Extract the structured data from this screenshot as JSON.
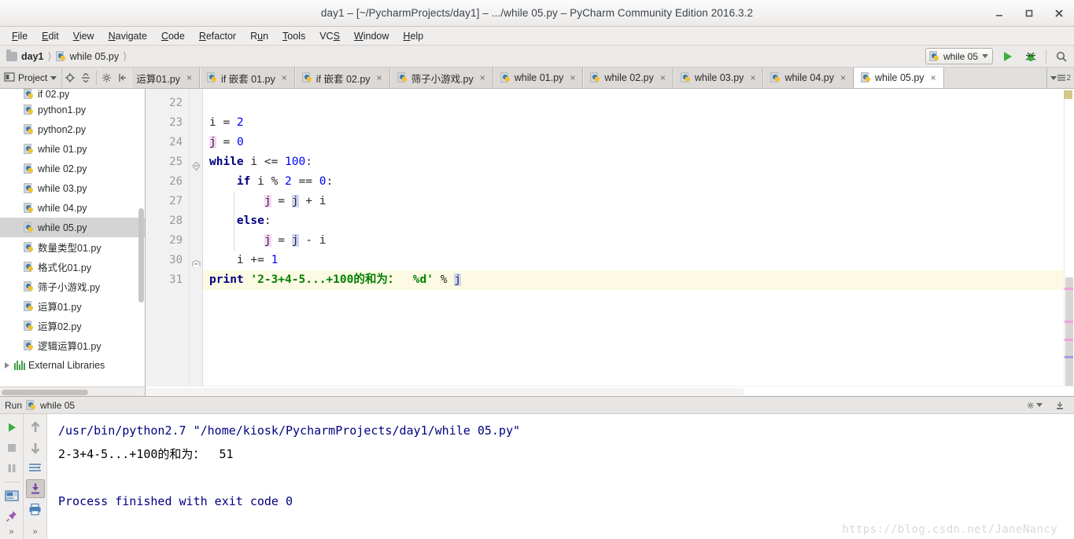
{
  "window": {
    "title": "day1 – [~/PycharmProjects/day1] – .../while 05.py – PyCharm Community Edition 2016.3.2",
    "minimize_label": "–",
    "maximize_label": "□",
    "close_label": "×"
  },
  "menubar": {
    "items": [
      {
        "pre": "",
        "mn": "F",
        "post": "ile",
        "name": "menu-file"
      },
      {
        "pre": "",
        "mn": "E",
        "post": "dit",
        "name": "menu-edit"
      },
      {
        "pre": "",
        "mn": "V",
        "post": "iew",
        "name": "menu-view"
      },
      {
        "pre": "",
        "mn": "N",
        "post": "avigate",
        "name": "menu-navigate"
      },
      {
        "pre": "",
        "mn": "C",
        "post": "ode",
        "name": "menu-code"
      },
      {
        "pre": "",
        "mn": "R",
        "post": "efactor",
        "name": "menu-refactor"
      },
      {
        "pre": "R",
        "mn": "u",
        "post": "n",
        "name": "menu-run"
      },
      {
        "pre": "",
        "mn": "T",
        "post": "ools",
        "name": "menu-tools"
      },
      {
        "pre": "VC",
        "mn": "S",
        "post": "",
        "name": "menu-vcs"
      },
      {
        "pre": "",
        "mn": "W",
        "post": "indow",
        "name": "menu-window"
      },
      {
        "pre": "",
        "mn": "H",
        "post": "elp",
        "name": "menu-help"
      }
    ]
  },
  "navbar": {
    "crumb_project": "day1",
    "crumb_file": "while 05.py",
    "run_config": "while 05",
    "run_button": "run-button",
    "debug_button": "debug-button",
    "search_button": "search-everywhere"
  },
  "tabbar": {
    "project_label": "Project",
    "tabs": [
      {
        "label": "运算01.py",
        "icon": false,
        "active": false
      },
      {
        "label": "if 嵌套 01.py",
        "icon": true,
        "active": false
      },
      {
        "label": "if 嵌套 02.py",
        "icon": true,
        "active": false
      },
      {
        "label": "筛子小游戏.py",
        "icon": true,
        "active": false
      },
      {
        "label": "while 01.py",
        "icon": true,
        "active": false
      },
      {
        "label": "while 02.py",
        "icon": true,
        "active": false
      },
      {
        "label": "while 03.py",
        "icon": true,
        "active": false
      },
      {
        "label": "while 04.py",
        "icon": true,
        "active": false
      },
      {
        "label": "while 05.py",
        "icon": true,
        "active": true
      }
    ],
    "overflow_count": "2",
    "close_glyph": "×"
  },
  "project_tree": {
    "items": [
      {
        "label": "if 02.py",
        "type": "py",
        "clipped": true,
        "selected": false
      },
      {
        "label": "python1.py",
        "type": "py",
        "selected": false
      },
      {
        "label": "python2.py",
        "type": "py",
        "selected": false
      },
      {
        "label": "while 01.py",
        "type": "py",
        "selected": false
      },
      {
        "label": "while 02.py",
        "type": "py",
        "selected": false
      },
      {
        "label": "while 03.py",
        "type": "py",
        "selected": false
      },
      {
        "label": "while 04.py",
        "type": "py",
        "selected": false
      },
      {
        "label": "while 05.py",
        "type": "py",
        "selected": true
      },
      {
        "label": "数量类型01.py",
        "type": "py",
        "selected": false
      },
      {
        "label": "格式化01.py",
        "type": "py",
        "selected": false
      },
      {
        "label": "筛子小游戏.py",
        "type": "py",
        "selected": false
      },
      {
        "label": "运算01.py",
        "type": "py",
        "selected": false
      },
      {
        "label": "运算02.py",
        "type": "py",
        "selected": false
      },
      {
        "label": "逻辑运算01.py",
        "type": "py",
        "selected": false
      },
      {
        "label": "External Libraries",
        "type": "lib",
        "selected": false
      }
    ]
  },
  "editor": {
    "line_numbers": [
      "22",
      "23",
      "24",
      "25",
      "26",
      "27",
      "28",
      "29",
      "30",
      "31"
    ],
    "lines": [
      {
        "n": "22",
        "text": "",
        "highlight": false
      },
      {
        "n": "23",
        "text": "i = 2",
        "highlight": false
      },
      {
        "n": "24",
        "text": "j = 0",
        "highlight": false
      },
      {
        "n": "25",
        "text": "while i <= 100:",
        "highlight": false
      },
      {
        "n": "26",
        "text": "    if i % 2 == 0:",
        "highlight": false
      },
      {
        "n": "27",
        "text": "        j = j + i",
        "highlight": false
      },
      {
        "n": "28",
        "text": "    else:",
        "highlight": false
      },
      {
        "n": "29",
        "text": "        j = j - i",
        "highlight": false
      },
      {
        "n": "30",
        "text": "    i += 1",
        "highlight": false
      },
      {
        "n": "31",
        "text": "print '2-3+4-5...+100的和为：  %d' % j",
        "highlight": true
      }
    ],
    "colors": {
      "keyword": "#000080",
      "number": "#0000ff",
      "string": "#008000",
      "write_highlight": "#f7d6f7",
      "read_highlight": "#d0d4f7",
      "caret_line": "#fdfae4"
    }
  },
  "run_panel": {
    "header_label": "Run",
    "header_config": "while 05",
    "toolbar": {
      "rerun": "rerun-button",
      "stop": "stop-button",
      "pause": "pause-button",
      "console": "console-button",
      "pin": "pin-tab-button",
      "up": "scroll-up-button",
      "down": "scroll-down-button",
      "soft_wrap": "soft-wrap-button",
      "scroll_to_end": "scroll-to-end-button",
      "print": "print-button",
      "more": "»",
      "settings": "settings-gear",
      "hide": "hide-button"
    },
    "console_lines": [
      {
        "text": "/usr/bin/python2.7 \"/home/kiosk/PycharmProjects/day1/while 05.py\"",
        "style": "cmd"
      },
      {
        "text": "2-3+4-5...+100的和为：  51",
        "style": "out"
      },
      {
        "text": "",
        "style": "out"
      },
      {
        "text": "Process finished with exit code 0",
        "style": "fin"
      }
    ],
    "watermark": "https://blog.csdn.net/JaneNancy"
  }
}
